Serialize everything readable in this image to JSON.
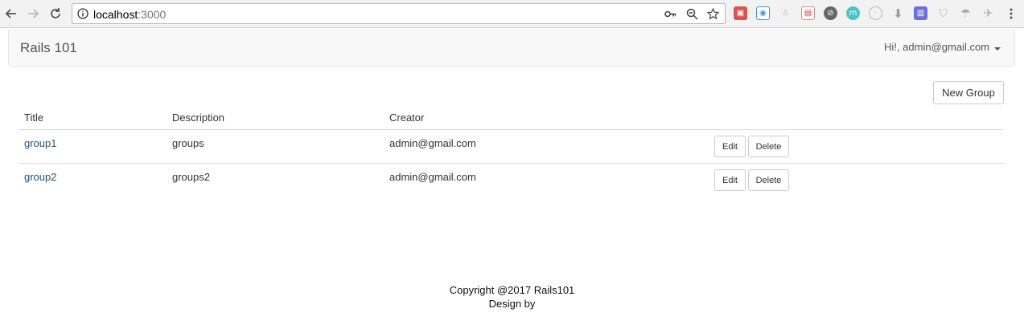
{
  "browser": {
    "url_host": "localhost",
    "url_port": ":3000"
  },
  "navbar": {
    "brand": "Rails 101",
    "user_greeting": "Hi!, admin@gmail.com"
  },
  "actions": {
    "new_group_label": "New Group"
  },
  "table": {
    "headers": [
      "Title",
      "Description",
      "Creator"
    ],
    "rows": [
      {
        "title": "group1",
        "description": "groups",
        "creator": "admin@gmail.com",
        "edit_label": "Edit",
        "delete_label": "Delete"
      },
      {
        "title": "group2",
        "description": "groups2",
        "creator": "admin@gmail.com",
        "edit_label": "Edit",
        "delete_label": "Delete"
      }
    ]
  },
  "footer": {
    "copyright": "Copyright @2017 Rails101",
    "design": "Design by"
  },
  "colors": {
    "link": "#23527c",
    "navbar_bg": "#f8f8f8"
  },
  "icons": [
    "back-arrow-icon",
    "forward-arrow-icon",
    "reload-icon",
    "info-icon",
    "key-icon",
    "zoom-icon",
    "star-icon",
    "menu-dots-icon"
  ]
}
